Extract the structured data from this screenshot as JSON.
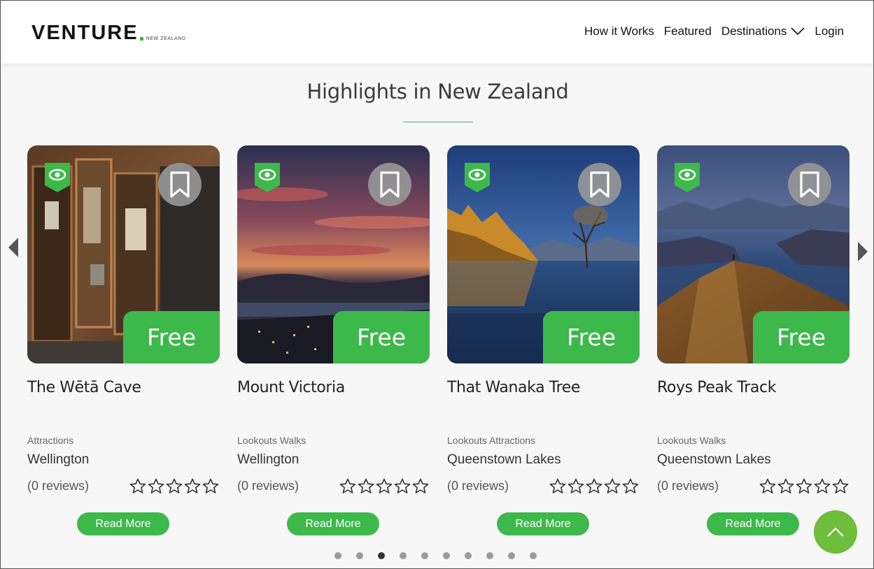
{
  "header": {
    "logo_main": "VENTURE",
    "logo_sub": "NEW ZEALAND",
    "nav": [
      "How it Works",
      "Featured",
      "Destinations",
      "Login"
    ]
  },
  "section": {
    "title": "Highlights in New Zealand"
  },
  "cards": [
    {
      "price": "Free",
      "title": "The Wētā Cave",
      "categories": "Attractions",
      "region": "Wellington",
      "reviews": "(0 reviews)",
      "cta": "Read More",
      "rating": 0
    },
    {
      "price": "Free",
      "title": "Mount Victoria",
      "categories": "Lookouts Walks",
      "region": "Wellington",
      "reviews": "(0 reviews)",
      "cta": "Read More",
      "rating": 0
    },
    {
      "price": "Free",
      "title": "That Wanaka Tree",
      "categories": "Lookouts Attractions",
      "region": "Queenstown Lakes",
      "reviews": "(0 reviews)",
      "cta": "Read More",
      "rating": 0
    },
    {
      "price": "Free",
      "title": "Roys Peak Track",
      "categories": "Lookouts Walks",
      "region": "Queenstown Lakes",
      "reviews": "(0 reviews)",
      "cta": "Read More",
      "rating": 0
    }
  ],
  "carousel": {
    "page_count": 10,
    "active_page": 3
  },
  "icons": {
    "eye_badge": "eye-icon",
    "bookmark": "bookmark-icon",
    "prev": "caret-left-icon",
    "next": "caret-right-icon",
    "to_top": "chevron-up-icon",
    "star": "star-outline-icon",
    "dropdown": "chevron-down-icon"
  },
  "colors": {
    "brand_green": "#3db84b",
    "to_top_green": "#6ebd3b",
    "badge_gray": "#969696"
  }
}
